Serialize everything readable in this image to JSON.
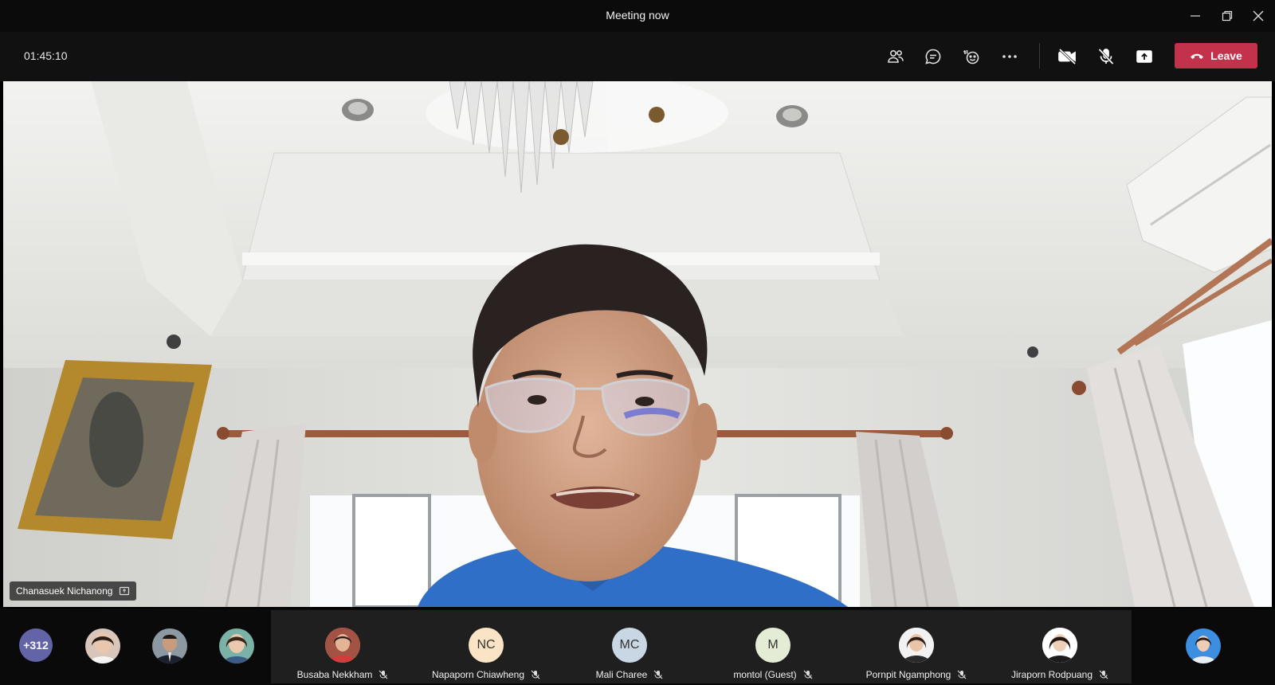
{
  "window": {
    "title": "Meeting now",
    "controls": [
      "minimize-icon",
      "restore-icon",
      "close-icon"
    ]
  },
  "toolbar": {
    "timer": "01:45:10",
    "buttons": [
      "participants-icon",
      "chat-icon",
      "reactions-icon",
      "more-options-icon",
      "camera-off-icon",
      "mic-off-icon",
      "share-screen-icon"
    ],
    "leave_label": "Leave",
    "leave_color": "#c4314b"
  },
  "stage": {
    "speaker_name": "Chanasuek Nichanong"
  },
  "strip": {
    "overflow_count": "+312",
    "tiles": [
      {
        "name": "Busaba Nekkham",
        "initials": "",
        "avatar_bg": "#d9a089"
      },
      {
        "name": "Napaporn Chiawheng",
        "initials": "NC",
        "avatar_bg": "#fbe3c5"
      },
      {
        "name": "Mali Charee",
        "initials": "MC",
        "avatar_bg": "#c9d7e4"
      },
      {
        "name": "montol (Guest)",
        "initials": "M",
        "avatar_bg": "#e4ecd6"
      },
      {
        "name": "Pornpit Ngamphong",
        "initials": "",
        "avatar_bg": "#e8d8cc"
      },
      {
        "name": "Jiraporn Rodpuang",
        "initials": "",
        "avatar_bg": "#f0e6e0"
      }
    ]
  }
}
